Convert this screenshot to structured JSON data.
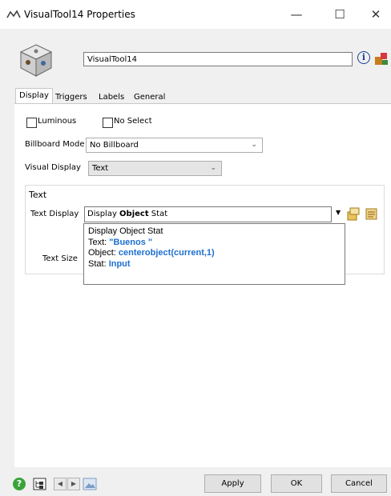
{
  "window": {
    "title": "VisualTool14  Properties",
    "controls": {
      "minimize": "—",
      "maximize": "☐",
      "close": "✕"
    }
  },
  "header": {
    "name_value": "VisualTool14",
    "info_icon_glyph": "i"
  },
  "tabs": [
    {
      "label": "Display",
      "active": true
    },
    {
      "label": "Triggers",
      "active": false
    },
    {
      "label": "Labels",
      "active": false
    },
    {
      "label": "General",
      "active": false
    }
  ],
  "display": {
    "luminous_label": "Luminous",
    "luminous_checked": false,
    "no_select_label": "No Select",
    "no_select_checked": false,
    "billboard_label": "Billboard Mode",
    "billboard_value": "No Billboard",
    "visual_display_label": "Visual Display",
    "visual_display_value": "Text",
    "text_group": {
      "title": "Text",
      "text_display_label": "Text Display",
      "text_display_prefix": "Display ",
      "text_display_bold": "Object",
      "text_display_suffix": " Stat",
      "text_size_label": "Text Size",
      "popup": {
        "line1": "Display Object Stat",
        "line2_label": "Text: ",
        "line2_value": "\"Buenos \"",
        "line3_label": "Object: ",
        "line3_value": "centerobject(current,1)",
        "line4_label": "Stat: ",
        "line4_value": "Input"
      }
    }
  },
  "footer": {
    "apply_label": "Apply",
    "ok_label": "OK",
    "cancel_label": "Cancel",
    "help_glyph": "?",
    "prev_glyph": "◀",
    "next_glyph": "▶"
  }
}
